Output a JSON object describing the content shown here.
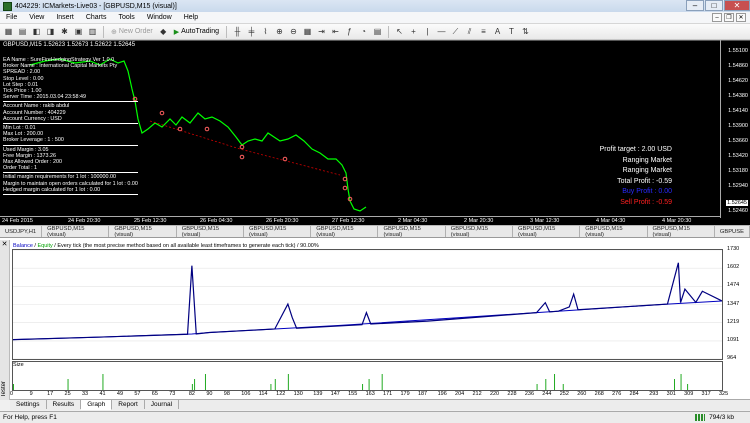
{
  "window": {
    "title": "404229: ICMarkets-Live03 - [GBPUSD,M15 (visual)]"
  },
  "menu": [
    "File",
    "View",
    "Insert",
    "Charts",
    "Tools",
    "Window",
    "Help"
  ],
  "toolbar": {
    "new_order": "New Order",
    "autotrading": "AutoTrading"
  },
  "chart": {
    "symbol_label": "GBPUSD,M15  1.52623 1.52673 1.52622 1.52645",
    "info_lines": [
      "EA Name : SureFireHedgingStrategy Ver 1.0.0",
      "Broker Name : International Capital Markets Pty",
      "SPREAD    :  2.00",
      "Stop Level   :  0.00",
      "Lot Step     :  0.01",
      "Tick Price   :  1.00",
      "Server Time : 2015.03.04 23:58:49"
    ],
    "account_lines": [
      "Account Name  :  rakib abdul",
      "Account Number  :  404229",
      "Account Currency  :  USD"
    ],
    "lot_lines": [
      "Min Lot  :  0.01",
      "Max Lot  :  200.00",
      "Broker Leverage  :  1 : 500"
    ],
    "margin_lines": [
      "Used Margin   :  3.05",
      "Free Margin   :  1373.26",
      "Max Allowed Order  :  200",
      "Order Total   :  1"
    ],
    "req_lines": [
      "Initial margin requirements for 1 lot  :  100000.00",
      "Margin to maintain open orders calculated for 1 lot  :  0.00",
      "Hedged margin calculated for 1 lot  :  0.00"
    ],
    "status": {
      "profit_target": "Profit target : 2.00 USD",
      "ranging1": "Ranging Market",
      "ranging2": "Ranging Market",
      "total_profit": "Total Profit  : -0.59",
      "buy_profit": "Buy Profit  : 0.00",
      "sell_profit": "Sell Profit : -0.59"
    },
    "price_ticks": [
      "1.55100",
      "1.54860",
      "1.54620",
      "1.54380",
      "1.54140",
      "1.53900",
      "1.53660",
      "1.53420",
      "1.53180",
      "1.52940",
      "1.52700",
      "1.52460"
    ],
    "current_price": "1.52645",
    "time_ticks": [
      "24 Feb 2015",
      "24 Feb 20:30",
      "25 Feb 12:30",
      "26 Feb 04:30",
      "26 Feb 20:30",
      "27 Feb 12:30",
      "2 Mar 04:30",
      "2 Mar 20:30",
      "3 Mar 12:30",
      "4 Mar 04:30",
      "4 Mar 20:30"
    ]
  },
  "chart_tabs": [
    "USDJPY,H1",
    "GBPUSD,M15 (visual)",
    "GBPUSD,M15 (visual)",
    "GBPUSD,M15 (visual)",
    "GBPUSD,M15 (visual)",
    "GBPUSD,M15 (visual)",
    "GBPUSD,M15 (visual)",
    "GBPUSD,M15 (visual)",
    "GBPUSD,M15 (visual)",
    "GBPUSD,M15 (visual)",
    "GBPUSD,M15 (visual)",
    "GBPUSE"
  ],
  "tester": {
    "side_label": "Tester",
    "graph_title_balance": "Balance",
    "graph_title_sep": " / ",
    "graph_title_equity": "Equity",
    "graph_title_rest": " / Every tick (the most precise method based on all available least timeframes to generate each tick) / 90.00%",
    "size_label": "Size",
    "tabs": [
      "Settings",
      "Results",
      "Graph",
      "Report",
      "Journal"
    ],
    "active_tab": "Graph"
  },
  "chart_data": {
    "type": "line",
    "y_ticks": [
      "1730",
      "1602",
      "1474",
      "1347",
      "1219",
      "1091",
      "964"
    ],
    "x_ticks": [
      "0",
      "9",
      "17",
      "25",
      "33",
      "41",
      "49",
      "57",
      "65",
      "73",
      "82",
      "90",
      "98",
      "106",
      "114",
      "122",
      "130",
      "139",
      "147",
      "155",
      "163",
      "171",
      "179",
      "187",
      "196",
      "204",
      "212",
      "220",
      "228",
      "236",
      "244",
      "252",
      "260",
      "268",
      "276",
      "284",
      "293",
      "301",
      "309",
      "317",
      "325"
    ],
    "ylim": [
      964,
      1730
    ],
    "xlim": [
      0,
      325
    ],
    "series": [
      {
        "name": "Balance",
        "color": "#0000c0",
        "x": [
          0,
          40,
          82,
          90,
          120,
          150,
          180,
          210,
          240,
          270,
          300,
          325
        ],
        "y": [
          1100,
          1118,
          1140,
          1150,
          1175,
          1200,
          1230,
          1260,
          1290,
          1320,
          1350,
          1372
        ]
      },
      {
        "name": "Equity",
        "color": "#000080",
        "x": [
          0,
          40,
          80,
          82,
          84,
          90,
          120,
          126,
          128,
          130,
          160,
          162,
          164,
          190,
          240,
          244,
          246,
          250,
          255,
          257,
          259,
          300,
          305,
          306,
          308,
          313,
          316,
          325
        ],
        "y": [
          1100,
          1118,
          1138,
          1620,
          1140,
          1150,
          1175,
          1350,
          1255,
          1180,
          1205,
          1290,
          1210,
          1230,
          1290,
          1360,
          1295,
          1300,
          1330,
          1420,
          1310,
          1350,
          1640,
          1360,
          1455,
          1362,
          1440,
          1372
        ]
      }
    ],
    "size_bars_x": [
      0,
      25,
      41,
      82,
      83,
      88,
      118,
      120,
      126,
      160,
      163,
      169,
      240,
      244,
      248,
      252,
      303,
      306,
      309
    ]
  },
  "statusbar": {
    "help": "For Help, press F1",
    "kb": "794/3 kb"
  }
}
